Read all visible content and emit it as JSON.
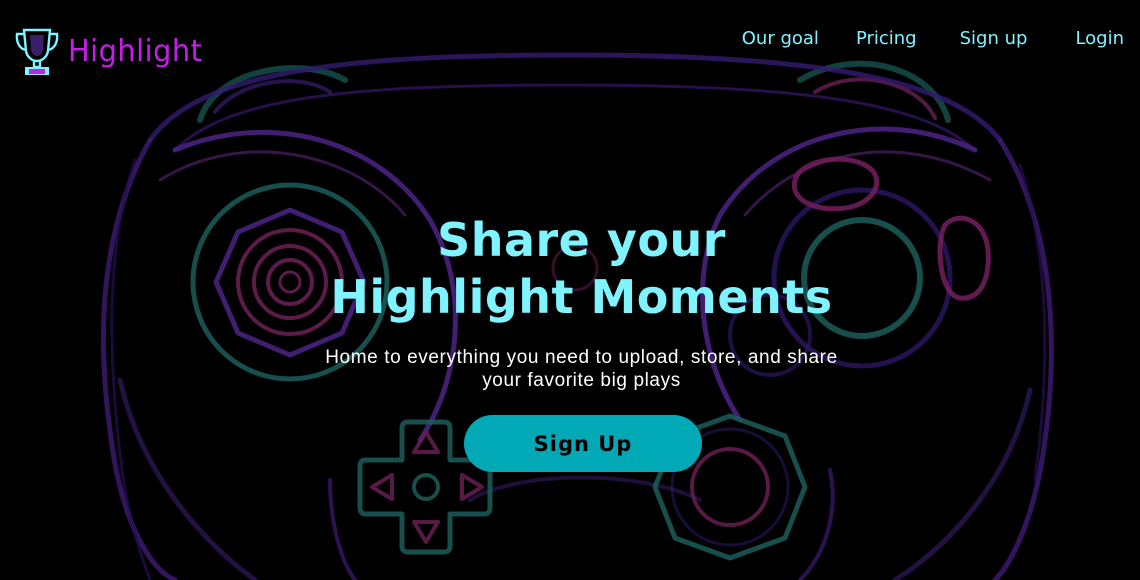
{
  "brand": {
    "name": "Highlight",
    "logo_icon": "trophy-icon",
    "color": "#c51ee6"
  },
  "nav": {
    "items": [
      {
        "label": "Our goal"
      },
      {
        "label": "Pricing"
      },
      {
        "label": "Sign up"
      },
      {
        "label": "Login"
      }
    ],
    "color": "#7ff3ff"
  },
  "hero": {
    "title_line1": "Share your",
    "title_line2": "Highlight Moments",
    "subtitle_line1": "Home to everything you need to upload, store, and share",
    "subtitle_line2": "your favorite big plays",
    "cta_label": "Sign Up",
    "cta_color": "#00a9b5",
    "background": "game-controller-neon-outline"
  },
  "colors": {
    "background": "#000000",
    "accent_cyan": "#7ff3ff",
    "accent_magenta": "#c51ee6",
    "outline_purple": "#5a2a9e",
    "outline_teal": "#1f6f6a"
  }
}
